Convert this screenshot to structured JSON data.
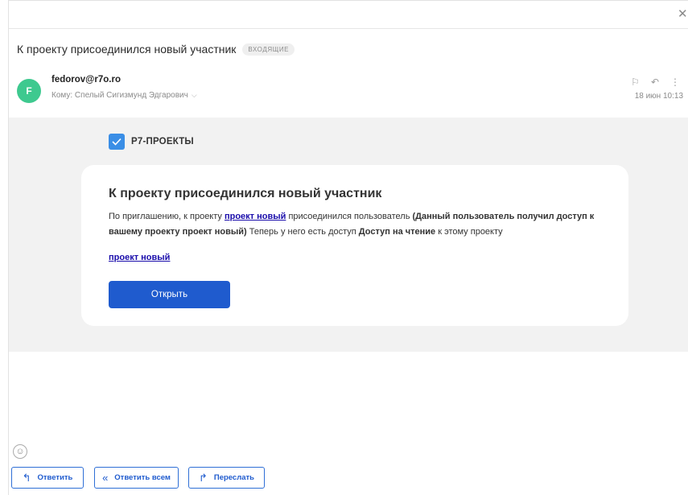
{
  "message": {
    "subject": "К проекту присоединился новый участник",
    "folder": "ВХОДЯЩИЕ",
    "avatar_letter": "F",
    "sender": "fedorov@r7o.ro",
    "recipient": "Кому: Спелый Сигизмунд Эдгарович",
    "date": "18 июн 10:13"
  },
  "body": {
    "brand": "Р7-ПРОЕКТЫ",
    "title": "К проекту присоединился новый участник",
    "text_1": "По приглашению, к проекту ",
    "project_link": "проект новый",
    "text_2": " присоединился пользователь ",
    "bold_1": "(Данный пользователь получил доступ к вашему проекту проект новый)",
    "text_3": " Теперь у него есть доступ ",
    "bold_2": "Доступ на чтение",
    "text_4": " к этому проекту",
    "link_2": "проект новый",
    "open_button": "Открыть"
  },
  "footer": {
    "reply": "Ответить",
    "reply_all": "Ответить всем",
    "forward": "Переслать"
  },
  "colors": {
    "accent": "#1f5bce",
    "avatar": "#3ec98f",
    "brand_check": "#3a8ee6"
  },
  "icons": {
    "close": "close-icon",
    "flag": "flag-icon",
    "reply": "reply-icon",
    "more": "more-vertical-icon",
    "emoji": "smiley-icon",
    "reply_all": "reply-all-icon",
    "forward": "forward-icon"
  }
}
